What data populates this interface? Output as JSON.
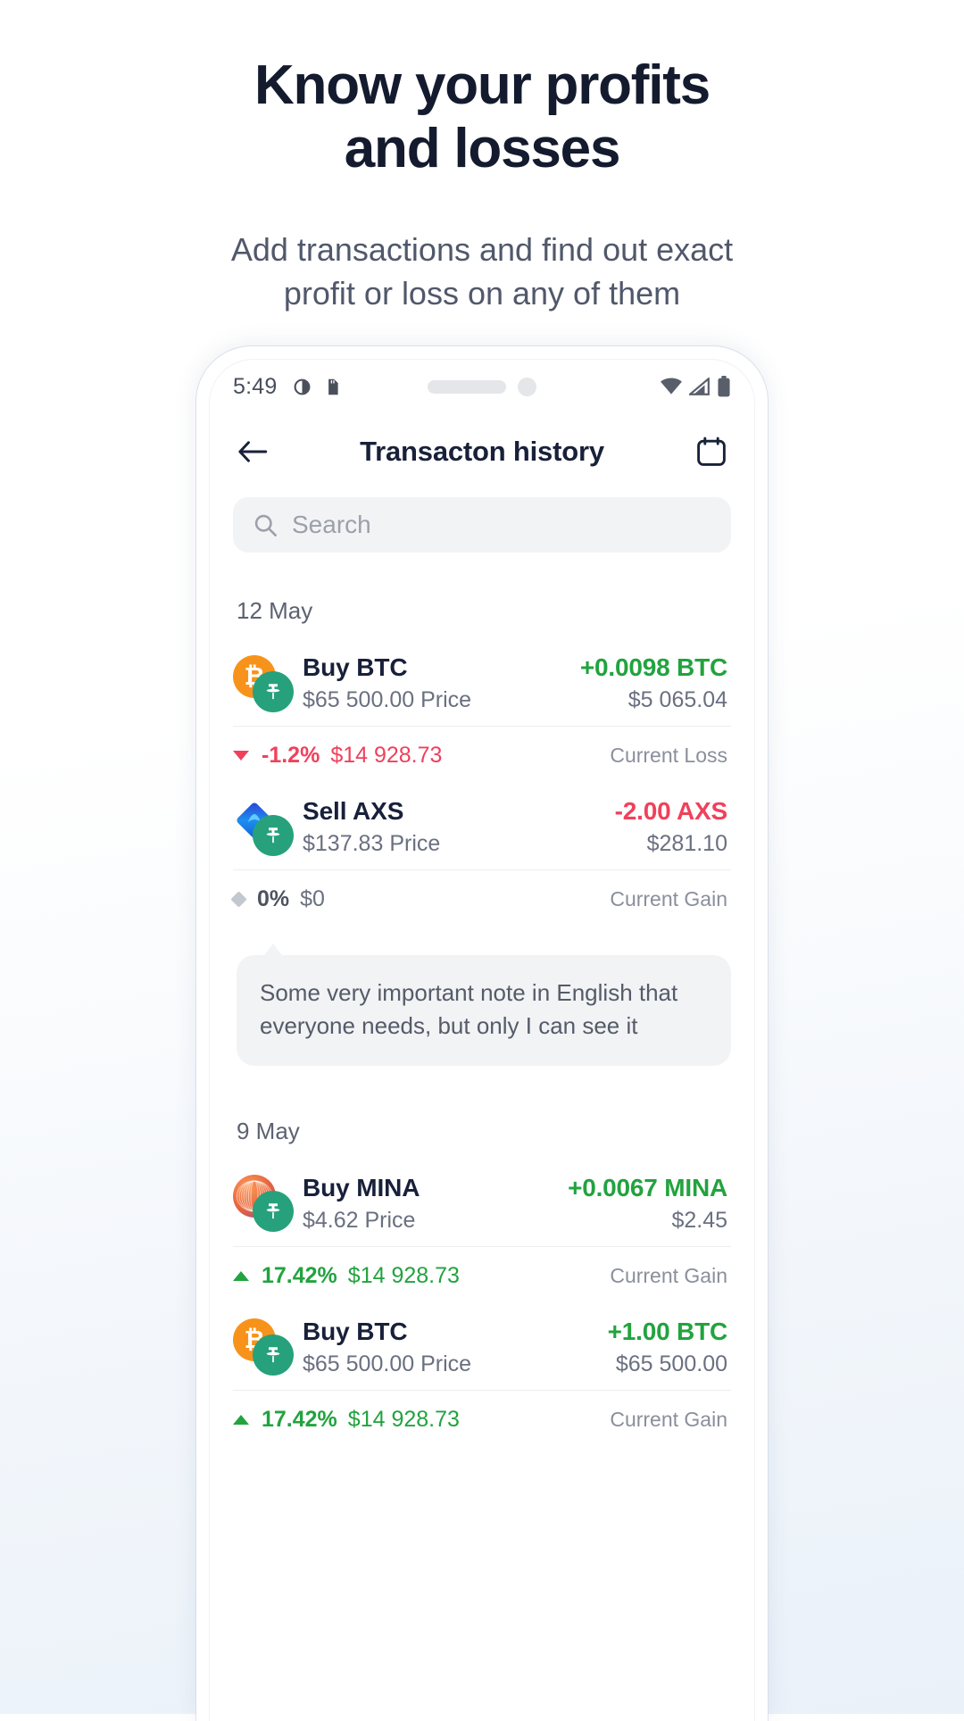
{
  "promo": {
    "title": "Know your profits\nand losses",
    "subtitle": "Add transactions and find out exact\nprofit or loss on any of them"
  },
  "statusbar": {
    "time": "5:49",
    "left_icons": [
      "brightness-icon",
      "sdcard-icon"
    ],
    "right_icons": [
      "wifi-icon",
      "signal-icon",
      "battery-icon"
    ]
  },
  "appbar": {
    "back_icon": "arrow-left-icon",
    "title": "Transacton history",
    "calendar_icon": "calendar-icon"
  },
  "search": {
    "placeholder": "Search",
    "icon": "search-icon"
  },
  "colors": {
    "positive": "#22a33f",
    "negative": "#f0415b",
    "neutral": "#c3c7cf",
    "title": "#18203a",
    "muted": "#6a7080"
  },
  "groups": [
    {
      "date": "12 May",
      "transactions": [
        {
          "coin": "BTC",
          "coin_symbol": "₿",
          "coin_color": "#f7931a",
          "badge": "tether-icon",
          "name": "Buy BTC",
          "price": "$65 500.00 Price",
          "amount": "+0.0098 BTC",
          "amount_dir": "pos",
          "usd": "$5 065.04",
          "pnl": {
            "dir": "down",
            "pct": "-1.2%",
            "value": "$14 928.73",
            "label": "Current Loss",
            "tone": "neg"
          },
          "note": null
        },
        {
          "coin": "AXS",
          "coin_symbol": "",
          "coin_color": "#1b5cf0",
          "badge": "tether-icon",
          "name": "Sell AXS",
          "price": "$137.83 Price",
          "amount": "-2.00 AXS",
          "amount_dir": "neg",
          "usd": "$281.10",
          "pnl": {
            "dir": "flat",
            "pct": "0%",
            "value": "$0",
            "label": "Current Gain",
            "tone": "flat"
          },
          "note": "Some very important note in English that everyone needs, but only I can see it"
        }
      ]
    },
    {
      "date": "9 May",
      "transactions": [
        {
          "coin": "MINA",
          "coin_symbol": "",
          "coin_color": "#e4643c",
          "badge": "tether-icon",
          "name": "Buy MINA",
          "price": "$4.62 Price",
          "amount": "+0.0067 MINA",
          "amount_dir": "pos",
          "usd": "$2.45",
          "pnl": {
            "dir": "up",
            "pct": "17.42%",
            "value": "$14 928.73",
            "label": "Current Gain",
            "tone": "pos"
          },
          "note": null
        },
        {
          "coin": "BTC",
          "coin_symbol": "₿",
          "coin_color": "#f7931a",
          "badge": "tether-icon",
          "name": "Buy BTC",
          "price": "$65 500.00 Price",
          "amount": "+1.00 BTC",
          "amount_dir": "pos",
          "usd": "$65 500.00",
          "pnl": {
            "dir": "up",
            "pct": "17.42%",
            "value": "$14 928.73",
            "label": "Current Gain",
            "tone": "pos"
          },
          "note": null
        }
      ]
    }
  ]
}
